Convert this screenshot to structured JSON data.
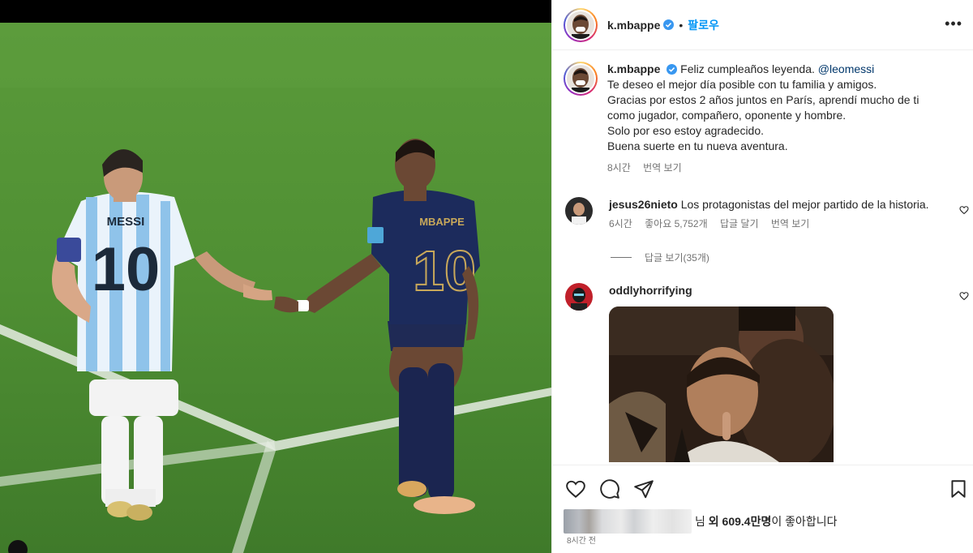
{
  "post": {
    "username": "k.mbappe",
    "follow_label": "팔로우",
    "dot": "•",
    "more_label": "•••"
  },
  "caption": {
    "username": "k.mbappe",
    "line1": "Feliz cumpleaños leyenda. ",
    "mention": "@leomessi",
    "line2": "Te deseo el mejor día posible con tu familia y amigos.",
    "line3": "Gracias por estos 2 años juntos en París, aprendí mucho de ti",
    "line4": "como jugador, compañero, oponente y hombre.",
    "line5": "Solo por eso estoy agradecido.",
    "line6": "Buena suerte en tu nueva aventura.",
    "time": "8시간",
    "translate": "번역 보기"
  },
  "comments": [
    {
      "username": "jesus26nieto",
      "text": "Los protagonistas del mejor partido de la historia.",
      "time": "6시간",
      "likes": "좋아요 5,752개",
      "reply": "답글 달기",
      "translate": "번역 보기"
    },
    {
      "username": "oddlyhorrifying"
    }
  ],
  "replies_label": "답글 보기(35개)",
  "likes": {
    "suffix_prefix": "님 ",
    "bold": "외 609.4만명",
    "suffix": "이 좋아합니다"
  },
  "post_time": "8시간 전",
  "jersey": {
    "left_name": "MESSI",
    "left_number": "10",
    "right_name": "MBAPPE",
    "right_number": "10"
  },
  "colors": {
    "accent": "#0095f6",
    "verified": "#3897f0",
    "mention": "#00376b",
    "muted": "#737373"
  }
}
